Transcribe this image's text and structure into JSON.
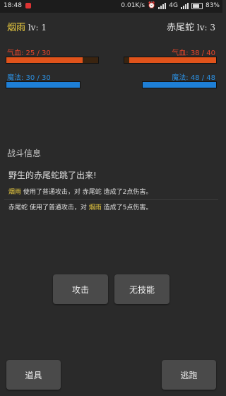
{
  "status_bar": {
    "time": "18:48",
    "network_speed": "0.01K/s",
    "network_type": "4G",
    "battery": "83%",
    "icons": [
      "notification-icon",
      "alarm-icon",
      "wifi-icon",
      "signal-icon",
      "battery-icon"
    ]
  },
  "player": {
    "name": "烟雨",
    "level": "lv: 1",
    "hp_label": "气血: 25 / 30",
    "hp_fraction": 0.833,
    "mp_label": "魔法: 30 / 30",
    "mp_fraction": 1.0
  },
  "enemy": {
    "name": "赤尾蛇",
    "level": "lv: 3",
    "hp_label": "气血: 38 / 40",
    "hp_fraction": 0.95,
    "mp_label": "魔法: 48 / 48",
    "mp_fraction": 1.0
  },
  "battle_log": {
    "title": "战斗信息",
    "headline": "野生的赤尾蛇跳了出来!",
    "line1": {
      "actor": "烟雨",
      "text_a": " 使用了普通攻击，对 ",
      "target": "赤尾蛇",
      "text_b": " 造成了2点伤害。"
    },
    "line2": {
      "actor": "赤尾蛇",
      "text_a": " 使用了普通攻击，对 ",
      "target": "烟雨",
      "text_b": " 造成了5点伤害。"
    }
  },
  "actions": {
    "attack": "攻击",
    "skill": "无技能",
    "item": "道具",
    "escape": "逃跑"
  },
  "colors": {
    "hp": "#e0531b",
    "mp": "#1e7fd6",
    "highlight": "#f0d040",
    "background": "#2a2a2a"
  }
}
